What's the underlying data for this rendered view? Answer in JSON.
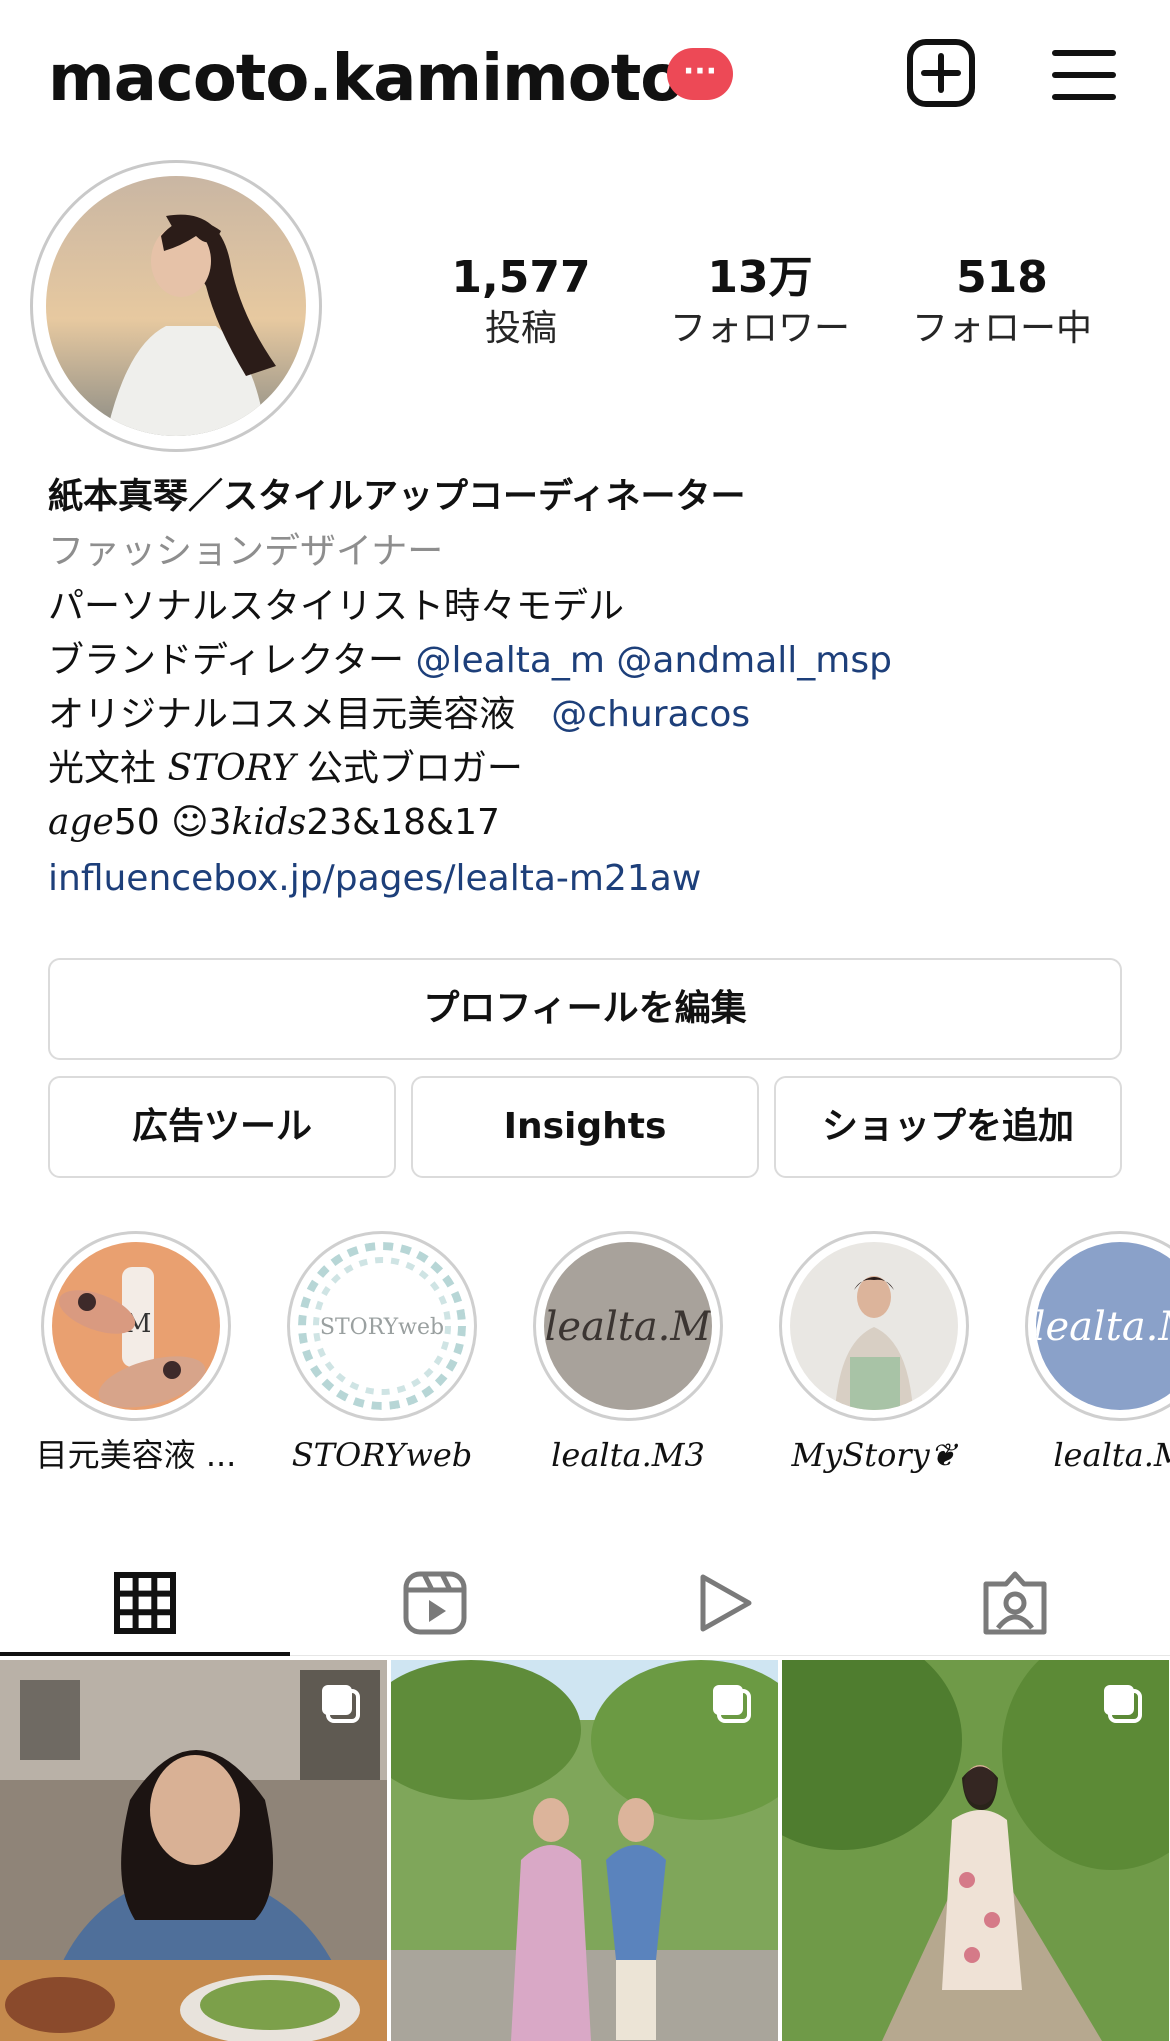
{
  "header": {
    "username": "macoto.kamimoto",
    "notification_badge": "···"
  },
  "stats": {
    "posts": {
      "value": "1,577",
      "label": "投稿"
    },
    "followers": {
      "value": "13万",
      "label": "フォロワー"
    },
    "following": {
      "value": "518",
      "label": "フォロー中"
    }
  },
  "bio": {
    "name": "紙本真琴／スタイルアップコーディネーター",
    "category": "ファッションデザイナー",
    "line1": "パーソナルスタイリスト時々モデル",
    "line2_text": "ブランドディレクター ",
    "line2_mention1": "@lealta_m",
    "line2_mention2": "@andmall_msp",
    "line3_text": "オリジナルコスメ目元美容液　",
    "line3_mention": "@churacos",
    "line4_prefix": "光文社 ",
    "line4_italic": "STORY",
    "line4_suffix": " 公式ブロガー",
    "line5_italic1": "age",
    "line5_mid": "50 ☺3",
    "line5_italic2": "kids",
    "line5_end": "23&18&17",
    "link": "influencebox.jp/pages/lealta-m21aw"
  },
  "buttons": {
    "edit_profile": "プロフィールを編集",
    "ad_tools": "広告ツール",
    "insights": "Insights",
    "add_shop": "ショップを追加"
  },
  "highlights": [
    {
      "label": "目元美容液 ..."
    },
    {
      "label": "STORYweb",
      "cover_text": "STORYweb"
    },
    {
      "label": "lealta.M3",
      "cover_text": "lealta.M"
    },
    {
      "label": "MyStory❦"
    },
    {
      "label": "lealta.M",
      "cover_text": "lealta.M"
    }
  ],
  "tabs": [
    "grid-icon",
    "reels-icon",
    "video-play-icon",
    "tagged-icon"
  ],
  "colors": {
    "link": "#1d3f7a",
    "badge": "#ed4956",
    "secondary_text": "#8e8e8e",
    "border": "#dbdbdb"
  }
}
